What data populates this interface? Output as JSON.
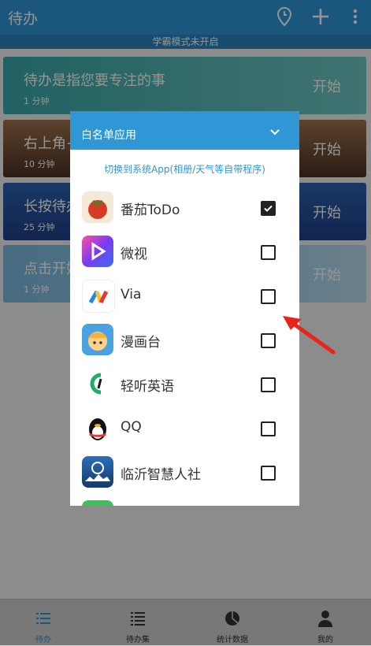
{
  "header": {
    "title": "待办",
    "icons": [
      "clock-pin-icon",
      "plus-icon",
      "more-vert-icon"
    ]
  },
  "banner": "学霸模式未开启",
  "cards": [
    {
      "title": "待办是指您要专注的事",
      "duration": "1 分钟",
      "start": "开始",
      "color": "#3fb4b0"
    },
    {
      "title": "右上角+",
      "duration": "10 分钟",
      "start": "开始",
      "color": "#8a5a3a"
    },
    {
      "title": "长按待办",
      "duration": "25 分钟",
      "start": "开始",
      "color": "#2a5ea8"
    },
    {
      "title": "点击开始",
      "duration": "1 分钟",
      "start": "开始",
      "color": "#8fc6e6"
    }
  ],
  "dialog": {
    "title": "白名单应用",
    "switch_link": "切换到系统App(相册/天气等自带程序)",
    "apps": [
      {
        "name": "番茄ToDo",
        "checked": true,
        "icon": "tomato-icon"
      },
      {
        "name": "微视",
        "checked": false,
        "icon": "weishi-icon"
      },
      {
        "name": "Via",
        "checked": false,
        "icon": "via-icon"
      },
      {
        "name": "漫画台",
        "checked": false,
        "icon": "manhuatai-icon"
      },
      {
        "name": "轻听英语",
        "checked": false,
        "icon": "qingting-icon"
      },
      {
        "name": "QQ",
        "checked": false,
        "icon": "qq-icon"
      },
      {
        "name": "临沂智慧人社",
        "checked": false,
        "icon": "linyi-icon"
      }
    ]
  },
  "nav": [
    {
      "label": "待办",
      "icon": "list-icon",
      "active": true
    },
    {
      "label": "待办集",
      "icon": "list-bullets-icon",
      "active": false
    },
    {
      "label": "统计数据",
      "icon": "pie-chart-icon",
      "active": false
    },
    {
      "label": "我的",
      "icon": "person-icon",
      "active": false
    }
  ],
  "colors": {
    "primary": "#2f97d6",
    "checkbox": "#222222",
    "arrow": "#e8241d"
  }
}
